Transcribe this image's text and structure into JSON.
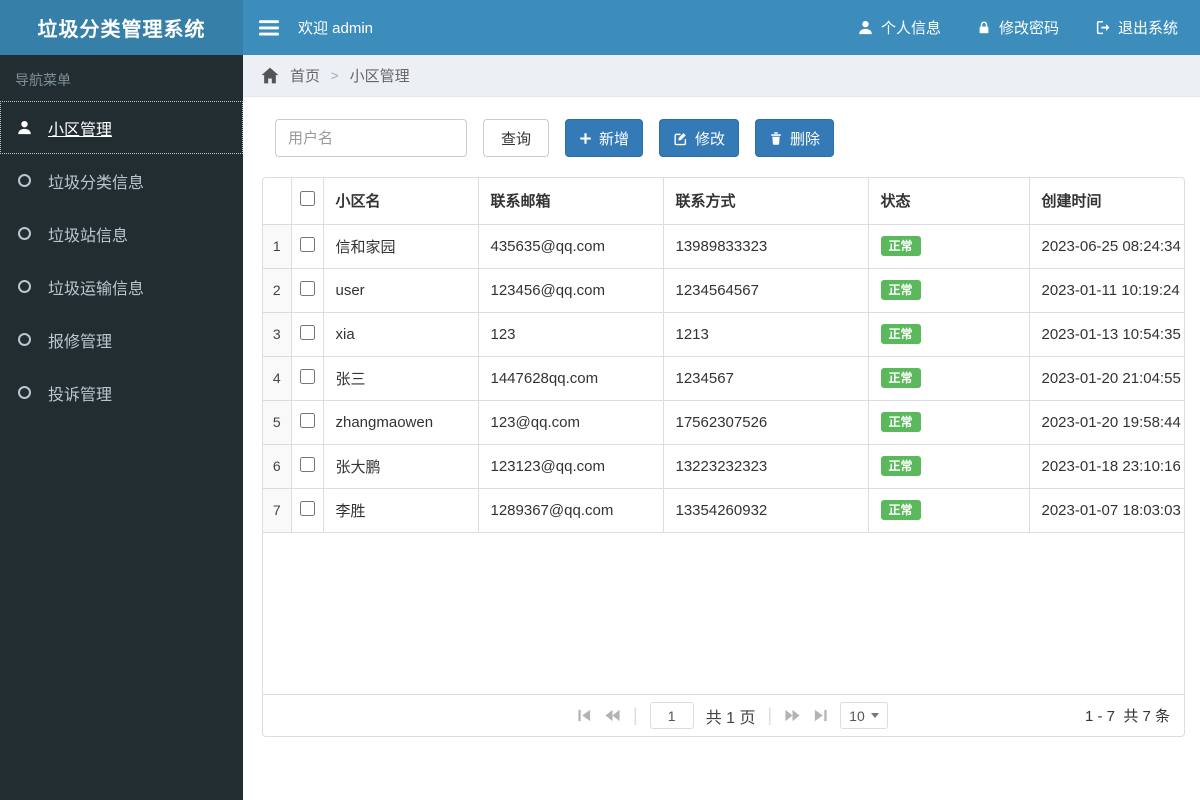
{
  "app": {
    "title": "垃圾分类管理系统"
  },
  "header": {
    "menu_icon": "hamburger-icon",
    "welcome": "欢迎 admin",
    "menu": [
      {
        "label": "个人信息",
        "icon": "user-icon"
      },
      {
        "label": "修改密码",
        "icon": "lock-icon"
      },
      {
        "label": "退出系统",
        "icon": "sign-out-icon"
      }
    ]
  },
  "sidebar": {
    "section_label": "导航菜单",
    "items": [
      {
        "label": "小区管理",
        "icon": "user-icon",
        "active": true
      },
      {
        "label": "垃圾分类信息",
        "icon": "circle-icon",
        "active": false
      },
      {
        "label": "垃圾站信息",
        "icon": "circle-icon",
        "active": false
      },
      {
        "label": "垃圾运输信息",
        "icon": "circle-icon",
        "active": false
      },
      {
        "label": "报修管理",
        "icon": "circle-icon",
        "active": false
      },
      {
        "label": "投诉管理",
        "icon": "circle-icon",
        "active": false
      }
    ]
  },
  "breadcrumb": {
    "home_icon": "home-icon",
    "home": "首页",
    "separator": ">",
    "current": "小区管理"
  },
  "toolbar": {
    "search_placeholder": "用户名",
    "query_label": "查询",
    "add_label": "新增",
    "edit_label": "修改",
    "delete_label": "删除"
  },
  "table": {
    "columns": [
      "小区名",
      "联系邮箱",
      "联系方式",
      "状态",
      "创建时间"
    ],
    "rows": [
      {
        "index": "1",
        "name": "信和家园",
        "email": "435635@qq.com",
        "phone": "13989833323",
        "status": "正常",
        "created": "2023-06-25 08:24:34"
      },
      {
        "index": "2",
        "name": "user",
        "email": "123456@qq.com",
        "phone": "1234564567",
        "status": "正常",
        "created": "2023-01-11 10:19:24"
      },
      {
        "index": "3",
        "name": "xia",
        "email": "123",
        "phone": "1213",
        "status": "正常",
        "created": "2023-01-13 10:54:35"
      },
      {
        "index": "4",
        "name": "张三",
        "email": "1447628qq.com",
        "phone": "1234567",
        "status": "正常",
        "created": "2023-01-20 21:04:55"
      },
      {
        "index": "5",
        "name": "zhangmaowen",
        "email": "123@qq.com",
        "phone": "17562307526",
        "status": "正常",
        "created": "2023-01-20 19:58:44"
      },
      {
        "index": "6",
        "name": "张大鹏",
        "email": "123123@qq.com",
        "phone": "13223232323",
        "status": "正常",
        "created": "2023-01-18 23:10:16"
      },
      {
        "index": "7",
        "name": "李胜",
        "email": "1289367@qq.com",
        "phone": "13354260932",
        "status": "正常",
        "created": "2023-01-07 18:03:03"
      }
    ]
  },
  "pagination": {
    "page_input": "1",
    "total_pages_label": "共 1 页",
    "page_size": "10",
    "summary": "1 - 7  共 7 条"
  },
  "colors": {
    "header_bg": "#3c8dbc",
    "logo_bg": "#367fa9",
    "sidebar_bg": "#222d32",
    "primary_button": "#337ab7",
    "status_badge_green": "#5cb85c",
    "breadcrumb_bg": "#ecf0f5"
  }
}
